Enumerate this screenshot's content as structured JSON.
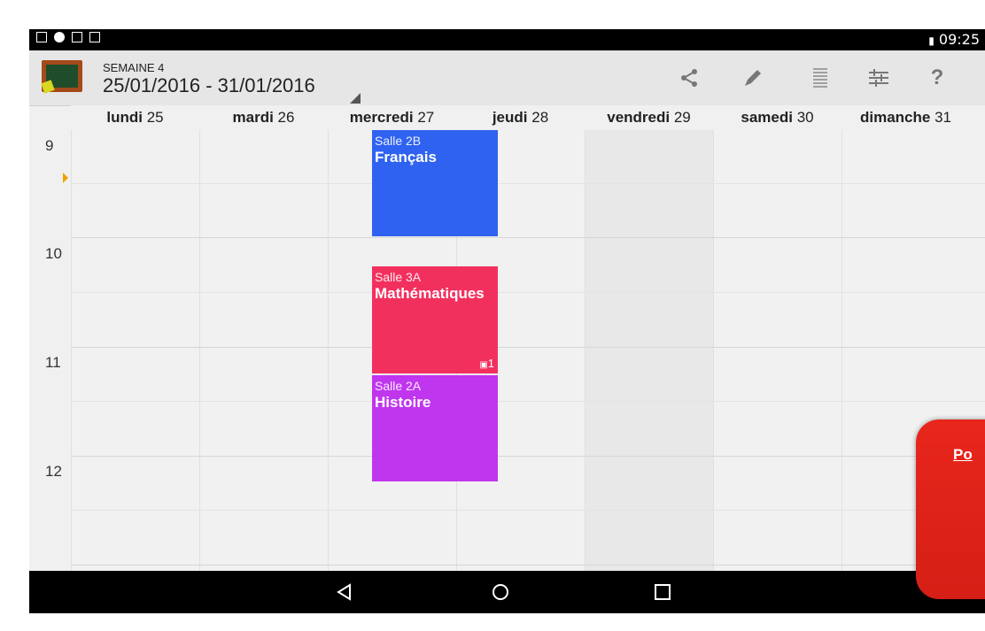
{
  "status_bar": {
    "time": "09:25"
  },
  "toolbar": {
    "week_label": "SEMAINE 4",
    "date_range": "25/01/2016 - 31/01/2016",
    "icons": [
      "share-icon",
      "pencil-icon",
      "list-icon",
      "sliders-icon",
      "help-icon"
    ],
    "help_label": "?"
  },
  "days": [
    {
      "name": "lundi",
      "num": "25"
    },
    {
      "name": "mardi",
      "num": "26"
    },
    {
      "name": "mercredi",
      "num": "27"
    },
    {
      "name": "jeudi",
      "num": "28"
    },
    {
      "name": "vendredi",
      "num": "29"
    },
    {
      "name": "samedi",
      "num": "30"
    },
    {
      "name": "dimanche",
      "num": "31"
    }
  ],
  "hours": [
    "9",
    "10",
    "11",
    "12"
  ],
  "events": [
    {
      "room": "Salle 2B",
      "subject": "Français",
      "color": "#2f62f0"
    },
    {
      "room": "Salle 3A",
      "subject": "Mathématiques",
      "color": "#f2305e",
      "badge": "1"
    },
    {
      "room": "Salle 2A",
      "subject": "Histoire",
      "color": "#c035ee"
    }
  ],
  "promo": {
    "text": "Po"
  }
}
